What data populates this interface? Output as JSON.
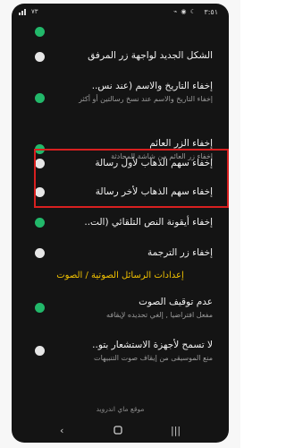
{
  "status": {
    "time": "٣:٥١",
    "battery": "٧٣",
    "icons": "⌁ ◉ ☾"
  },
  "rows": [
    {
      "title": "",
      "desc": "",
      "toggle": "on"
    },
    {
      "title": "الشكل الجديد لواجهة زر المرفق",
      "desc": "",
      "toggle": "off"
    },
    {
      "title": "إخفاء التاريخ والاسم (عند نس..",
      "desc": "إخفاء التاريخ والاسم عند نسخ رسالتين أو أكثر",
      "toggle": "on"
    },
    {
      "title": "إخفاء الزر العائم",
      "desc": "إخفاء زر العائم من شاشة المحادثة",
      "toggle": "on"
    },
    {
      "title": "إخفاء سهم الذهاب لأول رسالة",
      "desc": "",
      "toggle": "off"
    },
    {
      "title": "إخفاء سهم الذهاب لأخر رسالة",
      "desc": "",
      "toggle": "off"
    },
    {
      "title": "إخفاء أيقونة النص التلقائي (الت..",
      "desc": "",
      "toggle": "on"
    },
    {
      "title": "إخفاء زر الترجمة",
      "desc": "",
      "toggle": "off"
    }
  ],
  "section": {
    "title": "إعدادات الرسائل الصوتية / الصوت"
  },
  "rows2": [
    {
      "title": "عدم توقيف الصوت",
      "desc": "مفعل افتراضيا , إلغي تحديده لإيقافه",
      "toggle": "on"
    },
    {
      "title": "لا تسمح لأجهزة الاستشعار بتو..",
      "desc": "منع الموسيقى من إيقاف صوت التنبيهات",
      "toggle": "off"
    }
  ],
  "watermark": "موقع ماي اندرويد",
  "colors": {
    "accent": "#22b86a",
    "section": "#f0c000",
    "highlight": "#d82020"
  }
}
